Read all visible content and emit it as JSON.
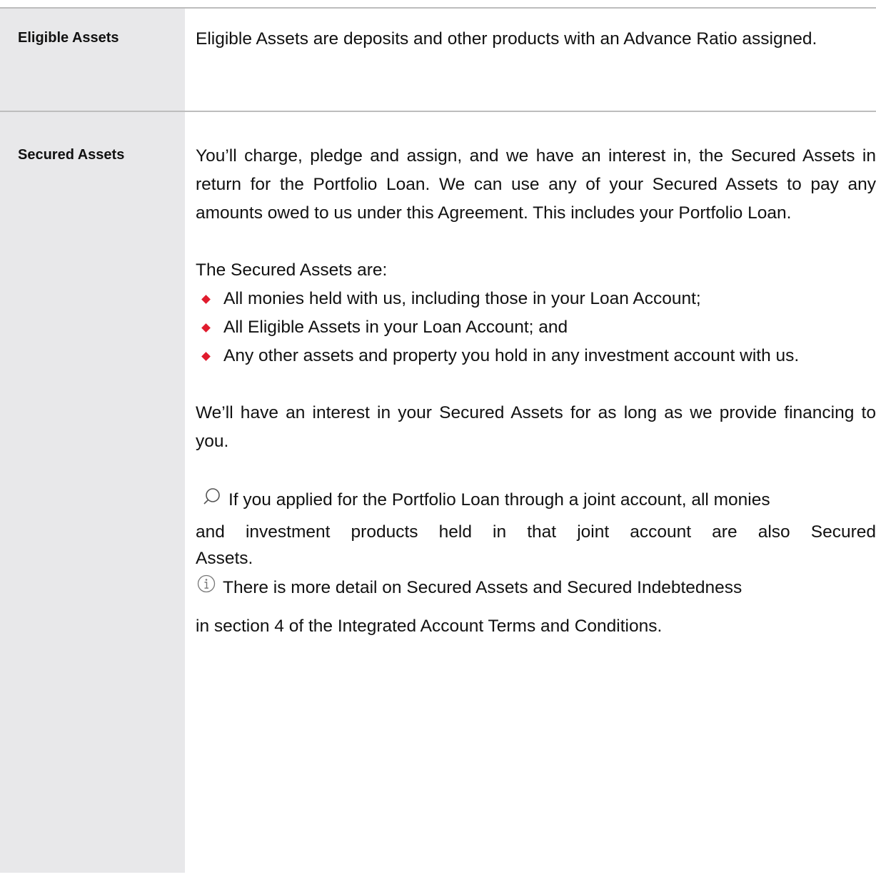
{
  "rows": [
    {
      "term": "Eligible Assets",
      "definition": "Eligible Assets are deposits and other products with an Advance Ratio assigned."
    },
    {
      "term": "Secured Assets",
      "intro": "You’ll charge, pledge and assign, and we have an interest in, the Secured Assets in return for the Portfolio Loan. We can use any of your Secured Assets to pay any amounts owed to us under this Agreement. This includes your Portfolio Loan.",
      "list_heading": "The Secured Assets are:",
      "bullets": [
        "All monies held with us, including those in your Loan Account;",
        "All Eligible Assets in your Loan Account; and",
        "Any other assets and property you hold in any investment account with us."
      ],
      "duration": "We’ll have an interest in your Secured Assets for as long as we provide financing to you.",
      "search_note_lines": [
        "If you applied for the Portfolio Loan through a joint account, all monies",
        "and investment products held in that joint account are also Secured",
        "Assets."
      ],
      "info_note_lines": [
        "There is more detail on Secured Assets and Secured Indebtedness",
        "in section 4 of the Integrated Account Terms and Conditions."
      ]
    }
  ],
  "icons": {
    "search": "search-icon",
    "info": "info-icon",
    "bullet": "diamond-bullet-icon"
  },
  "colors": {
    "term_column_bg": "#e8e8ea",
    "rule": "#bdbdbd",
    "bullet": "#e01b2d"
  }
}
